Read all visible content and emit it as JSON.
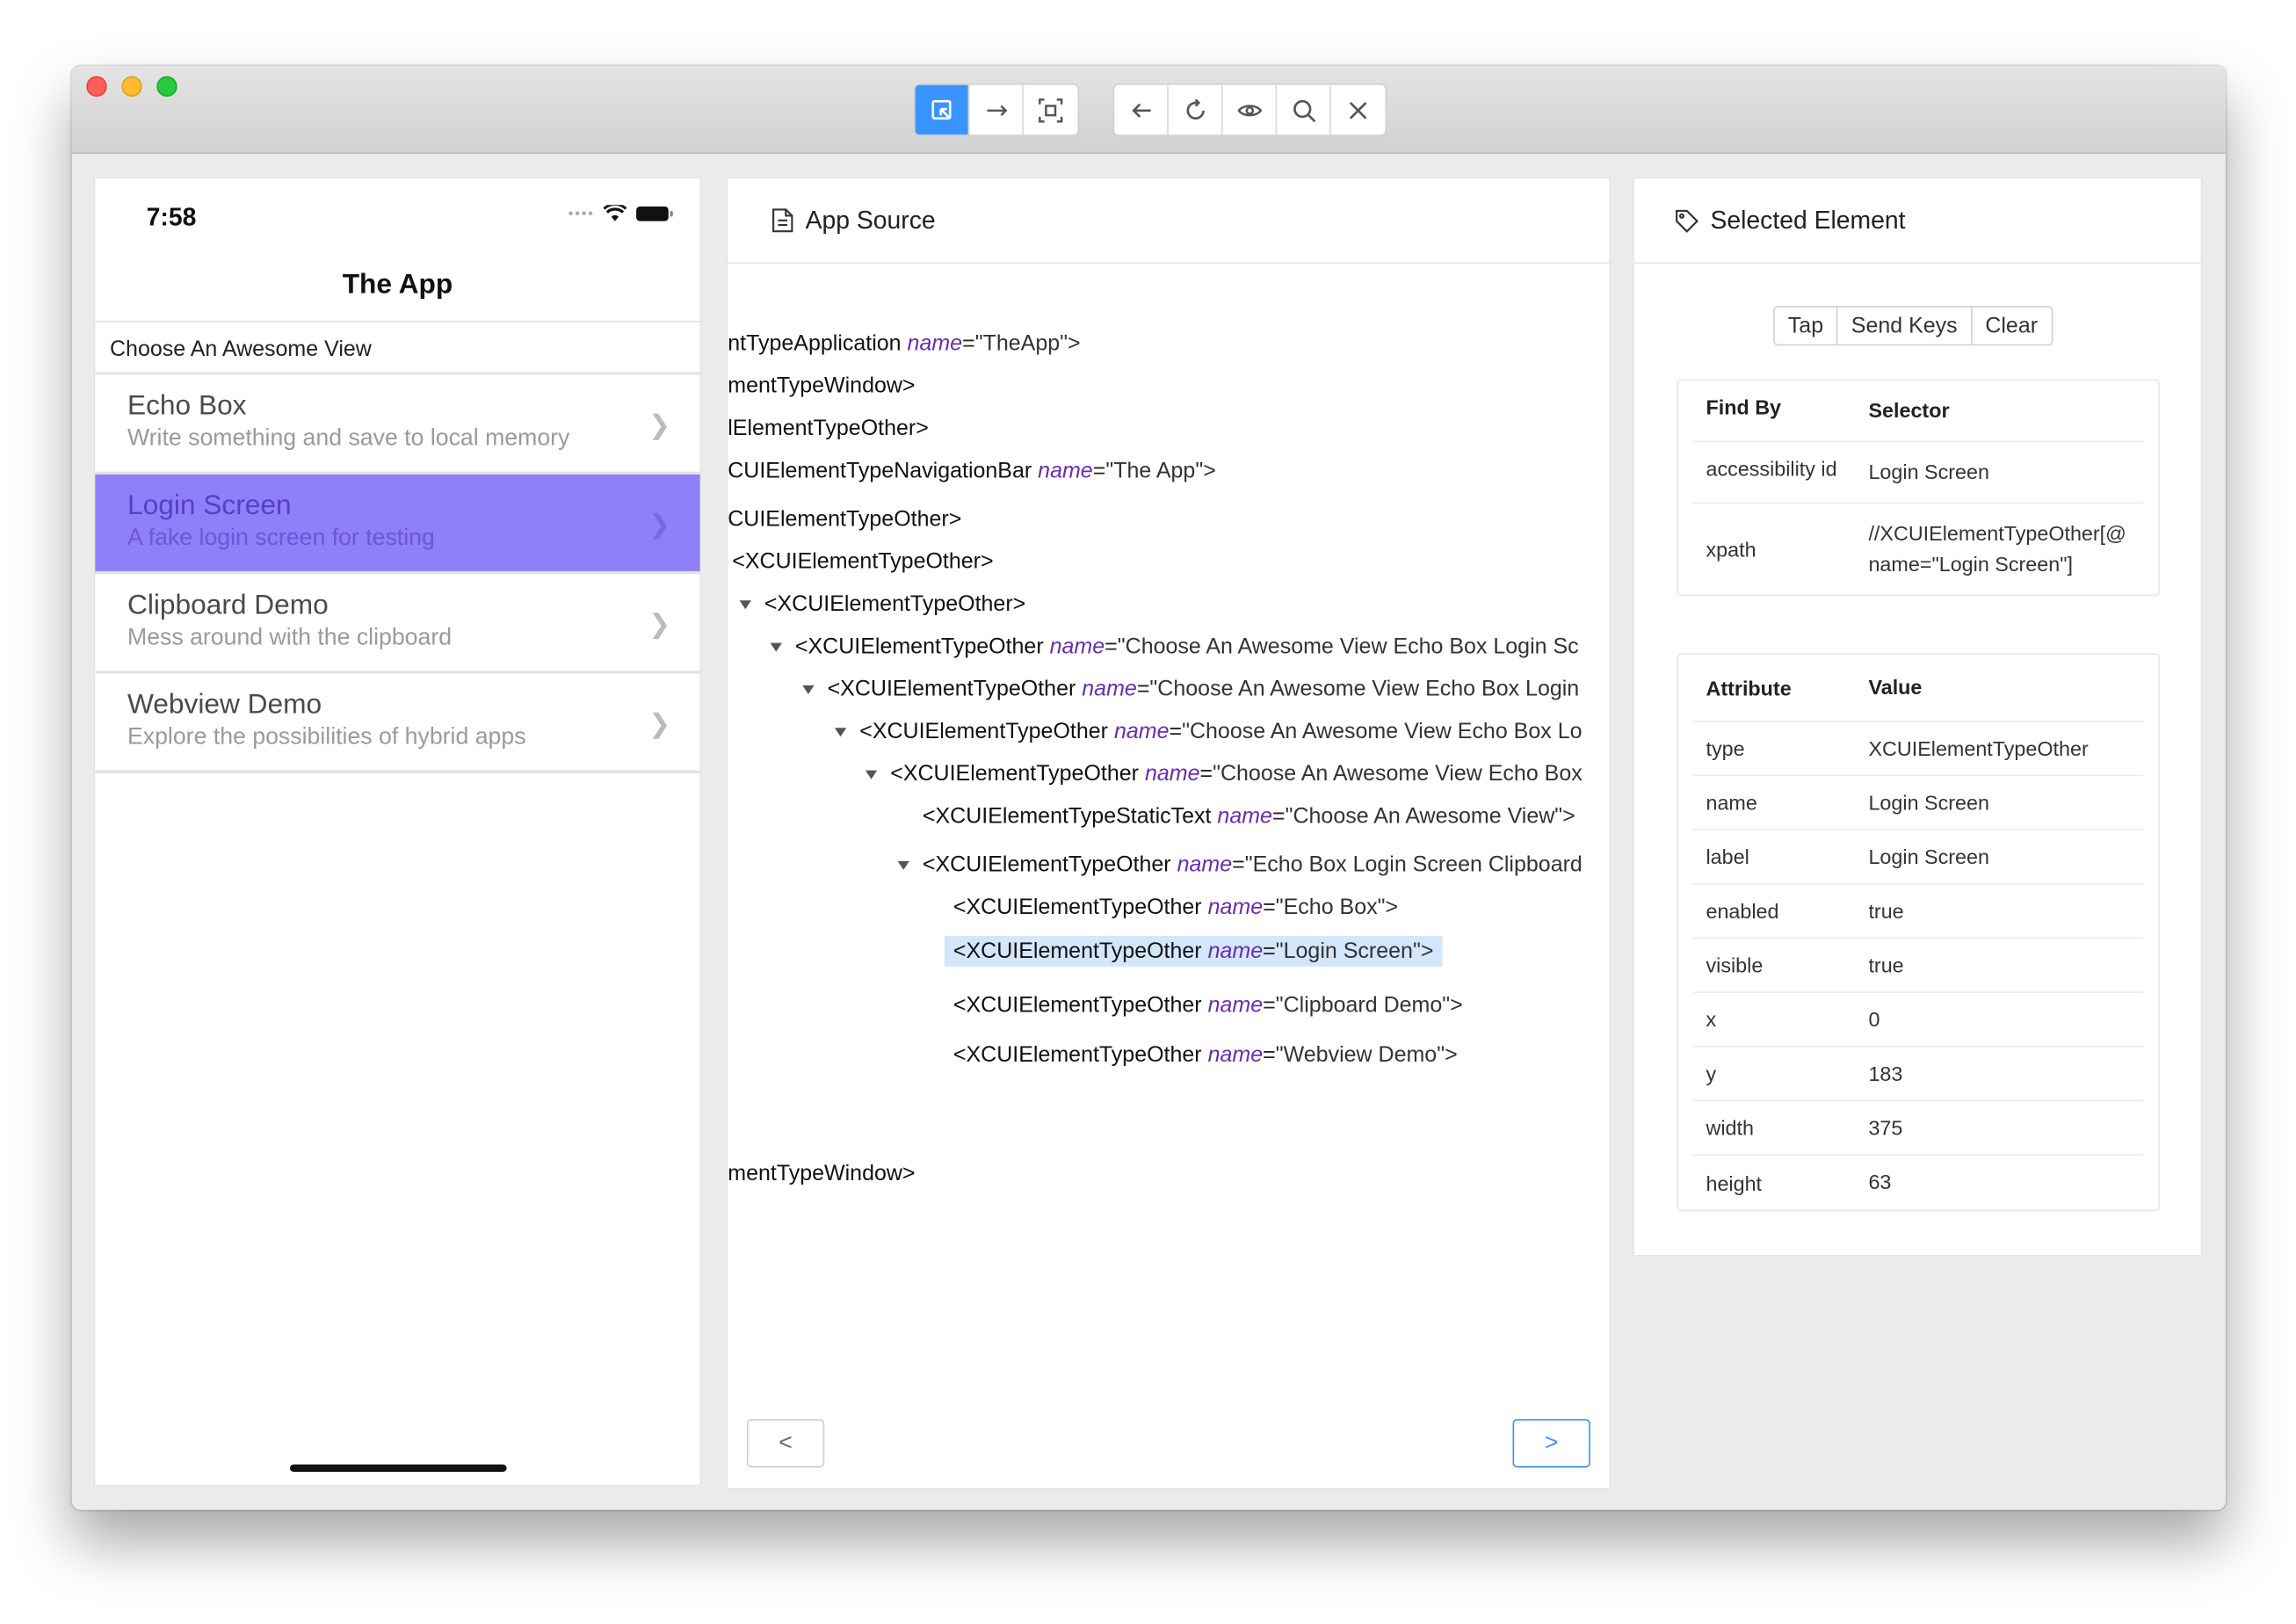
{
  "toolbar": {
    "group1_icons": [
      "select-element-icon",
      "swipe-icon",
      "tap-coordinates-icon"
    ],
    "group2_icons": [
      "back-icon",
      "refresh-icon",
      "eye-icon",
      "search-icon",
      "close-icon"
    ]
  },
  "phone": {
    "time": "7:58",
    "title": "The App",
    "section": "Choose An Awesome View",
    "items": [
      {
        "title": "Echo Box",
        "subtitle": "Write something and save to local memory"
      },
      {
        "title": "Login Screen",
        "subtitle": "A fake login screen for testing"
      },
      {
        "title": "Clipboard Demo",
        "subtitle": "Mess around with the clipboard"
      },
      {
        "title": "Webview Demo",
        "subtitle": "Explore the possibilities of hybrid apps"
      }
    ]
  },
  "source": {
    "title": "App Source",
    "nodes": [
      {
        "tag": "ntTypeApplication",
        "attr": "name",
        "val": "\"TheApp\">"
      },
      {
        "tag": "mentTypeWindow>",
        "attr": "",
        "val": ""
      },
      {
        "tag": "lElementTypeOther>",
        "attr": "",
        "val": ""
      },
      {
        "tag": "CUIElementTypeNavigationBar",
        "attr": "name",
        "val": "\"The App\">"
      },
      {
        "tag": "CUIElementTypeOther>",
        "attr": "",
        "val": ""
      },
      {
        "tag": "<XCUIElementTypeOther>",
        "attr": "",
        "val": ""
      },
      {
        "tag": "<XCUIElementTypeOther>",
        "attr": "",
        "val": ""
      },
      {
        "tag": "<XCUIElementTypeOther",
        "attr": "name",
        "val": "\"Choose An Awesome View Echo Box Login Sc"
      },
      {
        "tag": "<XCUIElementTypeOther",
        "attr": "name",
        "val": "\"Choose An Awesome View Echo Box Login"
      },
      {
        "tag": "<XCUIElementTypeOther",
        "attr": "name",
        "val": "\"Choose An Awesome View Echo Box Lo"
      },
      {
        "tag": "<XCUIElementTypeOther",
        "attr": "name",
        "val": "\"Choose An Awesome View Echo Box"
      },
      {
        "tag": "<XCUIElementTypeStaticText",
        "attr": "name",
        "val": "\"Choose An Awesome View\">"
      },
      {
        "tag": "<XCUIElementTypeOther",
        "attr": "name",
        "val": "\"Echo Box Login Screen Clipboard"
      },
      {
        "tag": "<XCUIElementTypeOther",
        "attr": "name",
        "val": "\"Echo Box\">"
      },
      {
        "tag": "<XCUIElementTypeOther",
        "attr": "name",
        "val": "\"Login Screen\">"
      },
      {
        "tag": "<XCUIElementTypeOther",
        "attr": "name",
        "val": "\"Clipboard Demo\">"
      },
      {
        "tag": "<XCUIElementTypeOther",
        "attr": "name",
        "val": "\"Webview Demo\">"
      },
      {
        "tag": "mentTypeWindow>",
        "attr": "",
        "val": ""
      }
    ],
    "equals": "=",
    "prev_label": "<",
    "next_label": ">"
  },
  "selected": {
    "title": "Selected Element",
    "actions": [
      "Tap",
      "Send Keys",
      "Clear"
    ],
    "find_headers": [
      "Find By",
      "Selector"
    ],
    "find_rows": [
      {
        "by": "accessibility id",
        "selector": "Login Screen"
      },
      {
        "by": "xpath",
        "selector": "//XCUIElementTypeOther[@name=\"Login Screen\"]"
      }
    ],
    "attr_headers": [
      "Attribute",
      "Value"
    ],
    "attr_rows": [
      {
        "attr": "type",
        "value": "XCUIElementTypeOther"
      },
      {
        "attr": "name",
        "value": "Login Screen"
      },
      {
        "attr": "label",
        "value": "Login Screen"
      },
      {
        "attr": "enabled",
        "value": "true"
      },
      {
        "attr": "visible",
        "value": "true"
      },
      {
        "attr": "x",
        "value": "0"
      },
      {
        "attr": "y",
        "value": "183"
      },
      {
        "attr": "width",
        "value": "375"
      },
      {
        "attr": "height",
        "value": "63"
      }
    ]
  }
}
